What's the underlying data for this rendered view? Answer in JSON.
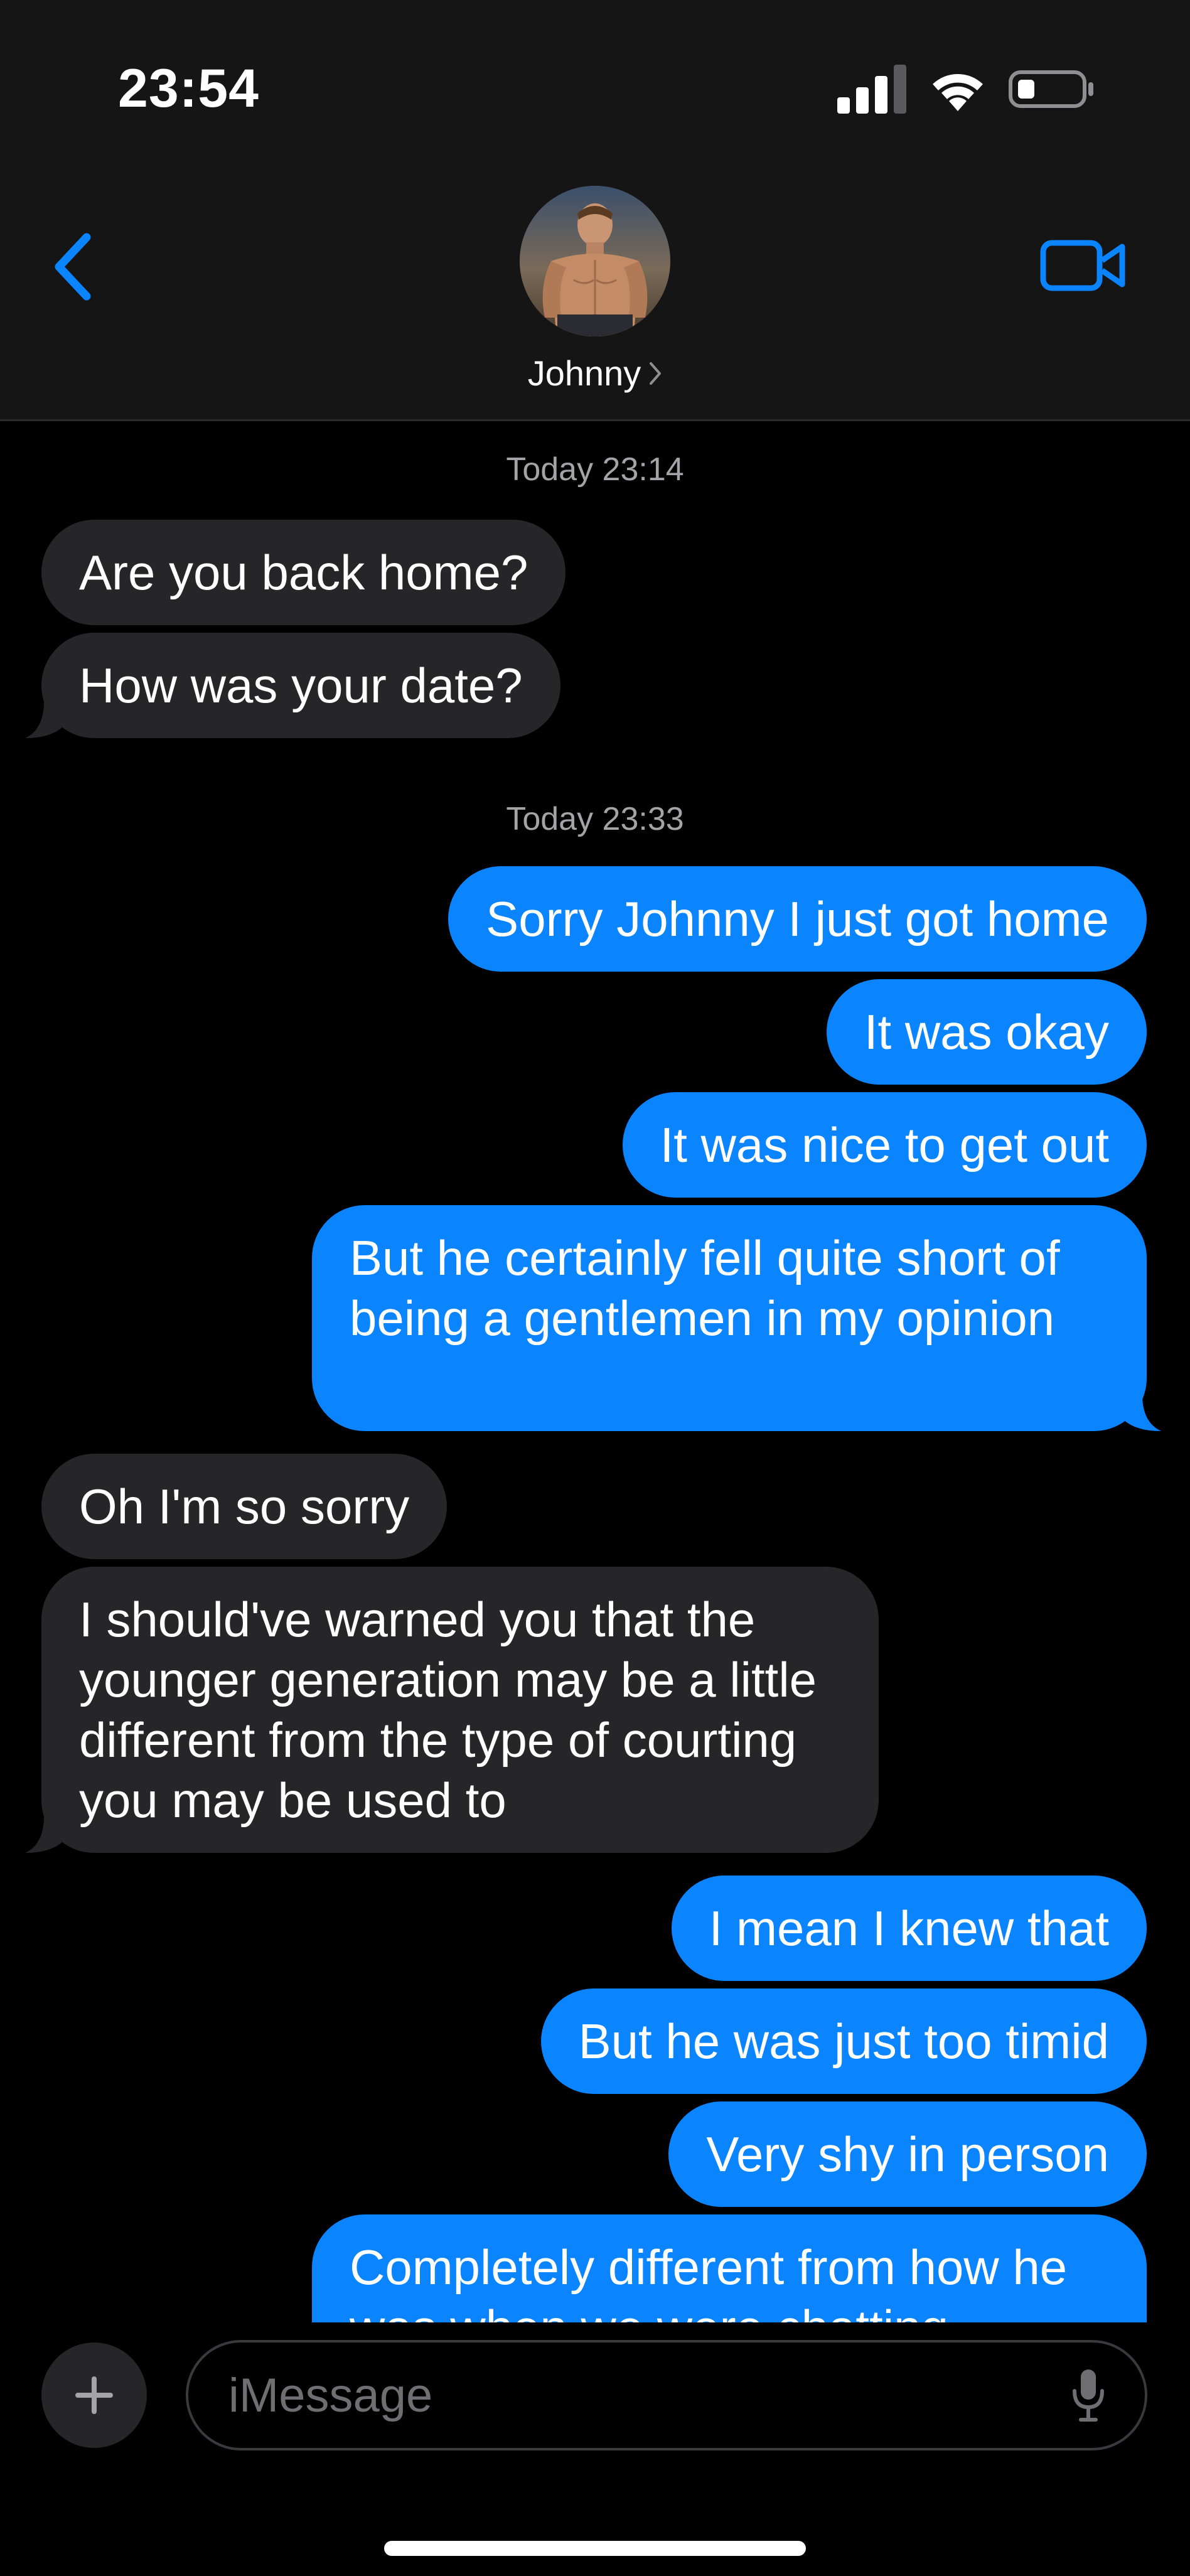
{
  "status_bar": {
    "time": "23:54",
    "icons": [
      "cellular-signal-icon",
      "wifi-icon",
      "battery-low-icon"
    ]
  },
  "header": {
    "contact_name": "Johnny",
    "icons": [
      "back-chevron-icon",
      "avatar-photo",
      "chevron-right-icon",
      "video-call-icon"
    ]
  },
  "conversation": {
    "timestamps": [
      "Today 23:14",
      "Today 23:33"
    ],
    "messages": [
      {
        "from": "them",
        "text": "Are you back home?"
      },
      {
        "from": "them",
        "text": "How was your date?"
      },
      {
        "from": "me",
        "text": "Sorry Johnny I just got home"
      },
      {
        "from": "me",
        "text": "It was okay"
      },
      {
        "from": "me",
        "text": "It was nice to get out"
      },
      {
        "from": "me",
        "text": "But he certainly fell quite short of being a gentlemen in my opinion"
      },
      {
        "from": "them",
        "text": "Oh I'm so sorry"
      },
      {
        "from": "them",
        "text": "I should've warned you that the younger generation may be a little different from the type of courting you may be used to"
      },
      {
        "from": "me",
        "text": "I mean I knew that"
      },
      {
        "from": "me",
        "text": "But he was just too timid"
      },
      {
        "from": "me",
        "text": "Very shy in person"
      },
      {
        "from": "me",
        "text": "Completely different from how he was when we were chatting"
      }
    ]
  },
  "composer": {
    "placeholder": "iMessage",
    "value": "",
    "icons": [
      "plus-icon",
      "microphone-icon"
    ]
  },
  "colors": {
    "background": "#000000",
    "header_background": "#151515",
    "incoming_bubble": "#262628",
    "outgoing_bubble": "#0a84ff",
    "accent": "#0a84ff",
    "timestamp_text": "#a3a3a8"
  }
}
